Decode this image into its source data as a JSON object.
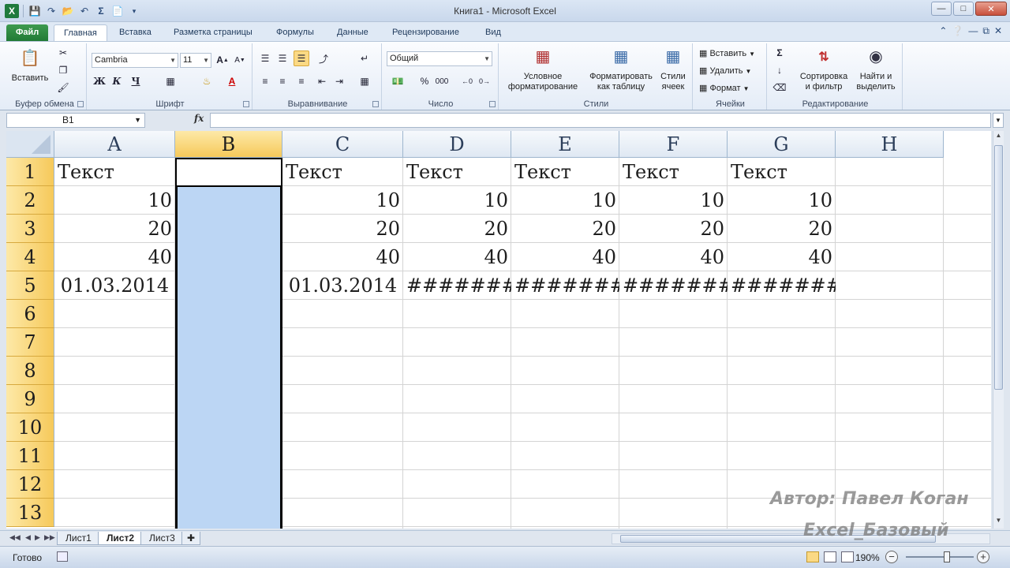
{
  "window": {
    "title": "Книга1  -  Microsoft Excel",
    "qat_icons": [
      "excel-logo",
      "save-icon",
      "redo-icon",
      "open-folder-icon",
      "undo-icon",
      "sum-icon",
      "new-file-icon"
    ]
  },
  "tabs": [
    {
      "label": "Файл",
      "kind": "file"
    },
    {
      "label": "Главная",
      "kind": "active"
    },
    {
      "label": "Вставка"
    },
    {
      "label": "Разметка страницы"
    },
    {
      "label": "Формулы"
    },
    {
      "label": "Данные"
    },
    {
      "label": "Рецензирование"
    },
    {
      "label": "Вид"
    }
  ],
  "ribbon": {
    "clipboard": {
      "paste_label": "Вставить",
      "group": "Буфер обмена"
    },
    "font": {
      "name": "Cambria",
      "size": "11",
      "group": "Шрифт",
      "bold": "Ж",
      "italic": "К",
      "underline": "Ч"
    },
    "alignment": {
      "group": "Выравнивание"
    },
    "number": {
      "format": "Общий",
      "group": "Число",
      "percent": "%",
      "thousands": "000"
    },
    "styles": {
      "cond_format_1": "Условное",
      "cond_format_2": "форматирование",
      "format_table_1": "Форматировать",
      "format_table_2": "как таблицу",
      "cell_styles_1": "Стили",
      "cell_styles_2": "ячеек",
      "group": "Стили"
    },
    "cells": {
      "insert": "Вставить",
      "delete": "Удалить",
      "format": "Формат",
      "group": "Ячейки"
    },
    "editing": {
      "sort_1": "Сортировка",
      "sort_2": "и фильтр",
      "find_1": "Найти и",
      "find_2": "выделить",
      "group": "Редактирование"
    }
  },
  "formula_bar": {
    "name_box": "B1",
    "fx": "fx",
    "content": ""
  },
  "grid": {
    "columns": [
      "A",
      "B",
      "C",
      "D",
      "E",
      "F",
      "G",
      "H"
    ],
    "selected_column": "B",
    "rows": [
      "1",
      "2",
      "3",
      "4",
      "5",
      "6",
      "7",
      "8",
      "9",
      "10",
      "11",
      "12",
      "13"
    ],
    "cells": {
      "A1": "Текст",
      "C1": "Текст",
      "D1": "Текст",
      "E1": "Текст",
      "F1": "Текст",
      "G1": "Текст",
      "A2": "10",
      "C2": "10",
      "D2": "10",
      "E2": "10",
      "F2": "10",
      "G2": "10",
      "A3": "20",
      "C3": "20",
      "D3": "20",
      "E3": "20",
      "F3": "20",
      "G3": "20",
      "A4": "40",
      "C4": "40",
      "D4": "40",
      "E4": "40",
      "F4": "40",
      "G4": "40",
      "A5": "01.03.2014",
      "C5": "01.03.2014",
      "D5": "#######",
      "E5": "#######",
      "F5": "#######",
      "G5": "#######"
    }
  },
  "sheets": [
    {
      "label": "Лист1"
    },
    {
      "label": "Лист2",
      "active": true
    },
    {
      "label": "Лист3"
    }
  ],
  "status": {
    "ready": "Готово",
    "zoom": "190%"
  },
  "watermark": {
    "line1": "Автор: Павел Коган",
    "line2": "Excel_Базовый"
  }
}
